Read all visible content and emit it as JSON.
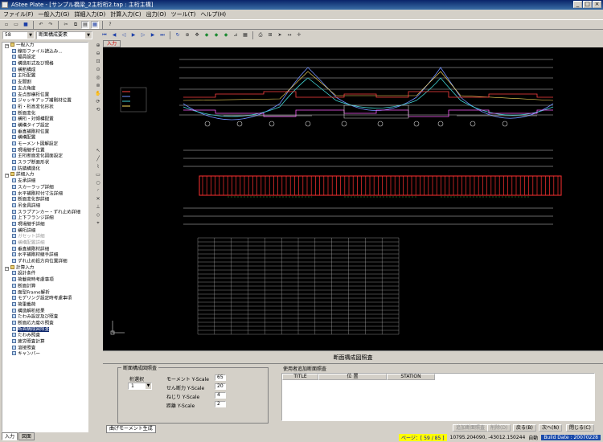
{
  "window": {
    "title": "AStee Plate - [サンプル橋梁_2主桁桁2.tap : 主桁主構]"
  },
  "menu": [
    {
      "label": "ファイル(F)"
    },
    {
      "label": "一般入力(G)"
    },
    {
      "label": "詳細入力(D)"
    },
    {
      "label": "計算入力(C)"
    },
    {
      "label": "出力(O)"
    },
    {
      "label": "ツール(T)"
    },
    {
      "label": "ヘルプ(H)"
    }
  ],
  "toolbar2": {
    "page_select": "58",
    "scope_select": "断面構成要素"
  },
  "tree": [
    {
      "label": "一般入力",
      "level": 0,
      "type": "folder"
    },
    {
      "label": "線形ファイル読込み...",
      "level": 1,
      "type": "doc"
    },
    {
      "label": "幅員設定",
      "level": 1,
      "type": "doc"
    },
    {
      "label": "構造形式及び規格",
      "level": 1,
      "type": "doc"
    },
    {
      "label": "横断構成",
      "level": 1,
      "type": "doc"
    },
    {
      "label": "主桁配置",
      "level": 1,
      "type": "doc"
    },
    {
      "label": "支間割",
      "level": 1,
      "type": "doc"
    },
    {
      "label": "支点角度",
      "level": 1,
      "type": "doc"
    },
    {
      "label": "支点部横桁位置",
      "level": 1,
      "type": "doc"
    },
    {
      "label": "ジャッキアップ補剛材位置",
      "level": 1,
      "type": "doc"
    },
    {
      "label": "桁・桁高変化形状",
      "level": 1,
      "type": "doc"
    },
    {
      "label": "断面変化",
      "level": 1,
      "type": "doc"
    },
    {
      "label": "横桁・対傾構配置",
      "level": 1,
      "type": "doc"
    },
    {
      "label": "横構タイプ設定",
      "level": 1,
      "type": "doc"
    },
    {
      "label": "垂直補剛材位置",
      "level": 1,
      "type": "doc"
    },
    {
      "label": "横構配置",
      "level": 1,
      "type": "doc"
    },
    {
      "label": "モーメント図解設定",
      "level": 1,
      "type": "doc"
    },
    {
      "label": "現場継手位置",
      "level": 1,
      "type": "doc"
    },
    {
      "label": "主桁断面変化図面設定",
      "level": 1,
      "type": "doc"
    },
    {
      "label": "スラブ断面形状",
      "level": 1,
      "type": "doc"
    },
    {
      "label": "防錆構造化",
      "level": 1,
      "type": "doc"
    },
    {
      "label": "詳細入力",
      "level": 0,
      "type": "folder"
    },
    {
      "label": "支承詳細",
      "level": 1,
      "type": "doc"
    },
    {
      "label": "スカーラップ詳細",
      "level": 1,
      "type": "doc"
    },
    {
      "label": "水平補剛材付寸法詳細",
      "level": 1,
      "type": "doc"
    },
    {
      "label": "断面変化部詳細",
      "level": 1,
      "type": "doc"
    },
    {
      "label": "吊金具詳細",
      "level": 1,
      "type": "doc"
    },
    {
      "label": "スラブアンカー・ずれ止め詳細",
      "level": 1,
      "type": "doc"
    },
    {
      "label": "上下フランジ詳細",
      "level": 1,
      "type": "doc"
    },
    {
      "label": "現場継手詳細",
      "level": 1,
      "type": "doc"
    },
    {
      "label": "横桁詳細",
      "level": 1,
      "type": "doc"
    },
    {
      "label": "ガセット詳細",
      "level": 1,
      "type": "doc",
      "disabled": true
    },
    {
      "label": "横構配置詳細",
      "level": 1,
      "type": "doc",
      "disabled": true
    },
    {
      "label": "垂直補剛材詳細",
      "level": 1,
      "type": "doc"
    },
    {
      "label": "水平補剛材継手詳細",
      "level": 1,
      "type": "doc"
    },
    {
      "label": "ずれ止め鉛方向位置詳細",
      "level": 1,
      "type": "doc"
    },
    {
      "label": "計算入力",
      "level": 0,
      "type": "folder"
    },
    {
      "label": "設計条件",
      "level": 1,
      "type": "doc"
    },
    {
      "label": "荷載荷時考慮事項",
      "level": 1,
      "type": "doc"
    },
    {
      "label": "断面計算",
      "level": 1,
      "type": "doc"
    },
    {
      "label": "面型Frame解析",
      "level": 1,
      "type": "doc"
    },
    {
      "label": "モデリング設定時考慮事項",
      "level": 1,
      "type": "doc"
    },
    {
      "label": "荷重載荷",
      "level": 1,
      "type": "doc"
    },
    {
      "label": "構造解析結果",
      "level": 1,
      "type": "doc"
    },
    {
      "label": "たわみ設定及び照査",
      "level": 1,
      "type": "doc"
    },
    {
      "label": "断面応力度の照査",
      "level": 1,
      "type": "doc"
    },
    {
      "label": "断面構成図照査",
      "level": 1,
      "type": "doc",
      "selected": true
    },
    {
      "label": "たわみ照査",
      "level": 1,
      "type": "doc"
    },
    {
      "label": "疲労照査計算",
      "level": 1,
      "type": "doc"
    },
    {
      "label": "溶接照査",
      "level": 1,
      "type": "doc"
    },
    {
      "label": "キャンバー",
      "level": 1,
      "type": "doc"
    }
  ],
  "left_tabs": {
    "input": "入力",
    "figure": "図面"
  },
  "input_tab": "入力",
  "panel": {
    "title": "断面構成図照査",
    "left_group": "断面構成図照査",
    "right_group": "使用者追加断面照査",
    "girder_label": "桁選択",
    "girder_value": "1",
    "fields": [
      {
        "label": "モーメント Y-Scale",
        "value": "65"
      },
      {
        "label": "せん断力 Y-Scale",
        "value": "20"
      },
      {
        "label": "ねじり Y-Scale",
        "value": "4"
      },
      {
        "label": "距離 Y-Scale",
        "value": "2"
      }
    ],
    "table_headers": [
      "TITLE",
      "位 置",
      "STATION"
    ],
    "buttons": {
      "add": "追加断面照査",
      "delete": "削除(D)",
      "prev": "戻る(B)",
      "next": "次へ(N)",
      "close": "閉じる(C)"
    },
    "bottom_tab": "曲げモーメント生成"
  },
  "status": {
    "page": "ページ：[ 59 / 85 ]",
    "coords": "10795.204090, -43012.150244",
    "mode": "自動",
    "build": "Build Date : 20070228"
  }
}
